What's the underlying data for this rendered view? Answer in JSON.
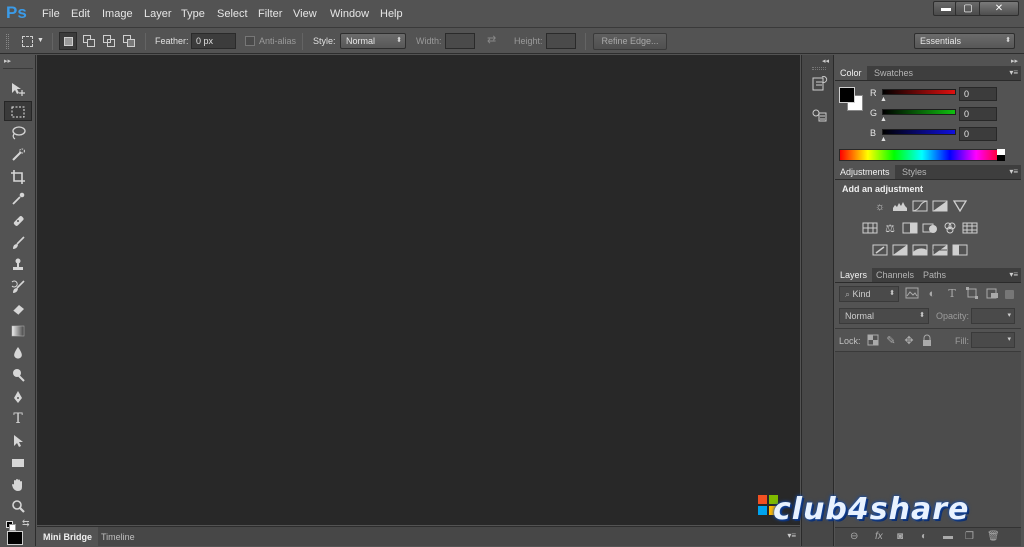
{
  "app": {
    "logo_text": "Ps"
  },
  "menu": [
    "File",
    "Edit",
    "Image",
    "Layer",
    "Type",
    "Select",
    "Filter",
    "View",
    "Window",
    "Help"
  ],
  "window_controls": {
    "minimize": "▬",
    "maximize": "▢",
    "close": "✕"
  },
  "options_bar": {
    "feather_label": "Feather:",
    "feather_value": "0 px",
    "antialias_label": "Anti-alias",
    "style_label": "Style:",
    "style_value": "Normal",
    "width_label": "Width:",
    "height_label": "Height:",
    "refine_edge_label": "Refine Edge...",
    "workspace_value": "Essentials"
  },
  "tools": [
    "move-tool-icon",
    "marquee-tool-icon",
    "lasso-tool-icon",
    "quick-selection-tool-icon",
    "crop-tool-icon",
    "eyedropper-tool-icon",
    "healing-brush-tool-icon",
    "brush-tool-icon",
    "clone-stamp-tool-icon",
    "history-brush-tool-icon",
    "eraser-tool-icon",
    "gradient-tool-icon",
    "blur-tool-icon",
    "dodge-tool-icon",
    "pen-tool-icon",
    "type-tool-icon",
    "path-selection-tool-icon",
    "rectangle-tool-icon",
    "hand-tool-icon",
    "zoom-tool-icon"
  ],
  "bottom_tabs": [
    "Mini Bridge",
    "Timeline"
  ],
  "color_panel": {
    "tabs": [
      "Color",
      "Swatches"
    ],
    "channels": [
      {
        "label": "R",
        "value": "0",
        "color": "#e01010"
      },
      {
        "label": "G",
        "value": "0",
        "color": "#10c010"
      },
      {
        "label": "B",
        "value": "0",
        "color": "#1010e0"
      }
    ]
  },
  "adjustments_panel": {
    "tabs": [
      "Adjustments",
      "Styles"
    ],
    "heading": "Add an adjustment"
  },
  "layers_panel": {
    "tabs": [
      "Layers",
      "Channels",
      "Paths"
    ],
    "filter_label": "Kind",
    "blend_mode": "Normal",
    "opacity_label": "Opacity:",
    "lock_label": "Lock:",
    "fill_label": "Fill:"
  },
  "watermark": {
    "text": "club4share"
  }
}
